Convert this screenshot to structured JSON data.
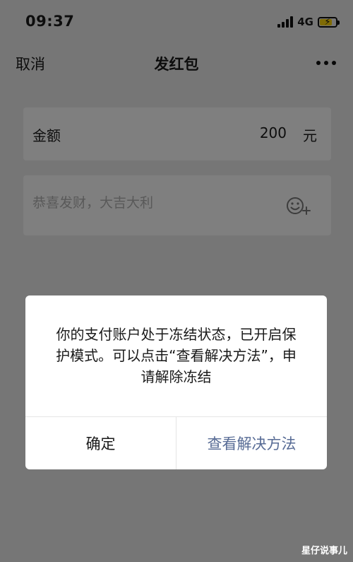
{
  "status_bar": {
    "time": "09:37",
    "network": "4G",
    "battery_level": 0.7,
    "battery_icon": "battery-charging-icon",
    "battery_color": "#ffd60a"
  },
  "nav": {
    "cancel_label": "取消",
    "title": "发红包",
    "more_icon": "more-icon"
  },
  "form": {
    "amount_label": "金额",
    "amount_value": "200",
    "amount_unit": "元",
    "greeting_placeholder": "恭喜发财，大吉大利",
    "emoji_icon": "emoji-add-icon"
  },
  "dialog": {
    "message": "你的支付账户处于冻结状态，已开启保护模式。可以点击“查看解决方法”，申请解除冻结",
    "confirm_label": "确定",
    "solution_label": "查看解决方法",
    "solution_color": "#576b95"
  },
  "watermark": "星仔说事儿"
}
